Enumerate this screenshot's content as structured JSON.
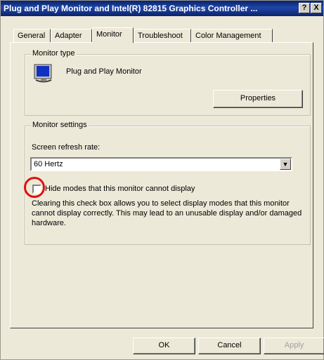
{
  "window": {
    "title": "Plug and Play Monitor and Intel(R) 82815 Graphics Controller ...",
    "help_label": "?",
    "close_label": "X"
  },
  "tabs": [
    {
      "label": "General"
    },
    {
      "label": "Adapter"
    },
    {
      "label": "Monitor",
      "active": true
    },
    {
      "label": "Troubleshoot"
    },
    {
      "label": "Color Management"
    }
  ],
  "monitor_type": {
    "group_label": "Monitor type",
    "monitor_name": "Plug and Play Monitor",
    "properties_label": "Properties"
  },
  "monitor_settings": {
    "group_label": "Monitor settings",
    "refresh_label": "Screen refresh rate:",
    "refresh_value": "60 Hertz",
    "hide_modes_label": "Hide modes that this monitor cannot display",
    "hide_modes_checked": false,
    "description": "Clearing this check box allows you to select display modes that this monitor cannot display correctly. This may lead to an unusable display and/or damaged hardware."
  },
  "footer": {
    "ok_label": "OK",
    "cancel_label": "Cancel",
    "apply_label": "Apply"
  },
  "colors": {
    "title_bar": "#0a246a",
    "face": "#ece9d8",
    "highlight_circle": "#e01010"
  }
}
